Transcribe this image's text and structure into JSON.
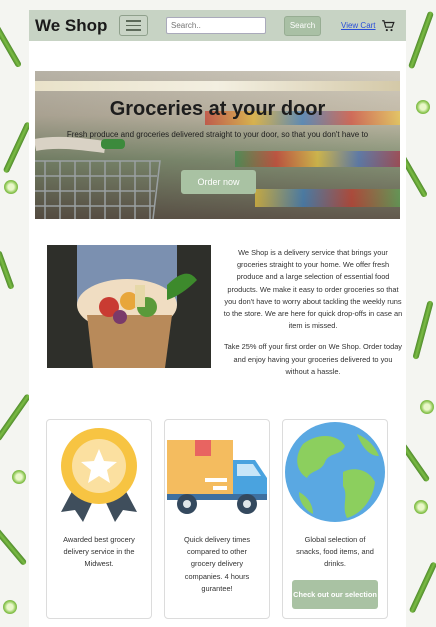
{
  "navbar": {
    "brand": "We Shop",
    "search_placeholder": "Search..",
    "search_button": "Search",
    "view_cart": "View Cart"
  },
  "hero": {
    "title": "Groceries at your door",
    "subtitle": "Fresh produce and groceries delivered straight to your door, so that you don't have to",
    "order_button": "Order now"
  },
  "about": {
    "paragraph1": "We Shop is a delivery service that brings your groceries straight to your home. We offer fresh produce and a large selection of essential food products. We make it easy to order groceries so that you don't have to worry about tackling the weekly runs to the store. We are here for quick drop-offs in case an item is missed.",
    "paragraph2": "Take 25% off your first order on We Shop. Order today and enjoy having your groceries delivered to you without a hassle."
  },
  "cards": [
    {
      "icon": "award-medal-icon",
      "text": "Awarded best grocery delivery service in the Midwest."
    },
    {
      "icon": "delivery-truck-icon",
      "text": "Quick delivery times compared to other grocery delivery companies. 4 hours gurantee!"
    },
    {
      "icon": "globe-icon",
      "text": "Global selection of snacks, food items, and drinks.",
      "button": "Check out our selection"
    }
  ],
  "colors": {
    "navbar": "#c7d3c4",
    "button": "#a9c2a3",
    "link": "#2a4ed8"
  }
}
